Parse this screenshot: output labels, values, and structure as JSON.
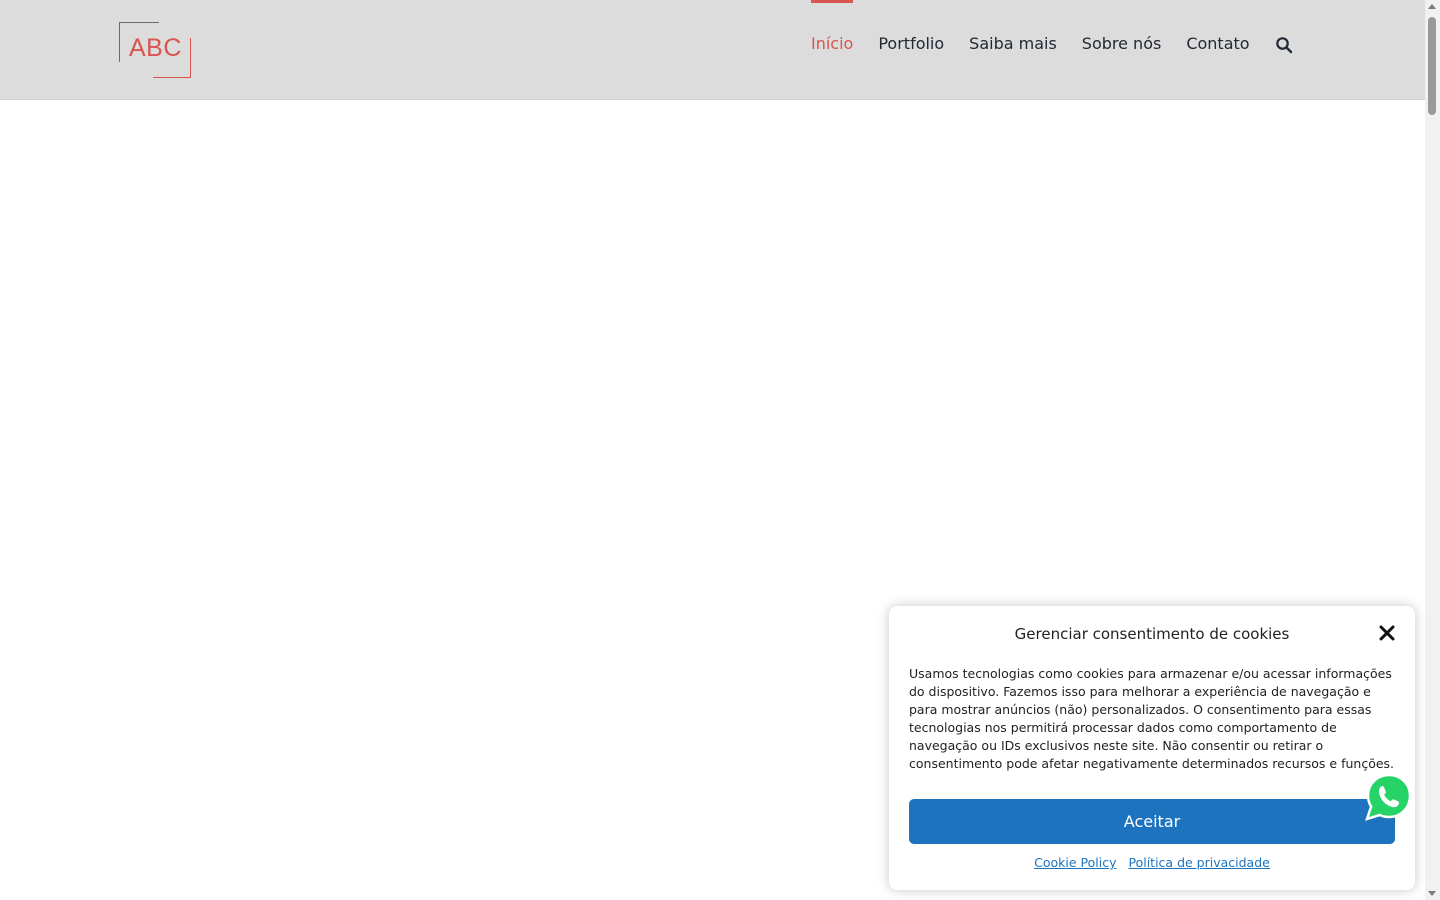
{
  "header": {
    "logo_text": "ABC",
    "nav": [
      {
        "label": "Início",
        "active": true
      },
      {
        "label": "Portfolio",
        "active": false
      },
      {
        "label": "Saiba mais",
        "active": false
      },
      {
        "label": "Sobre nós",
        "active": false
      },
      {
        "label": "Contato",
        "active": false
      }
    ],
    "search_icon": "search-icon"
  },
  "cookie_dialog": {
    "title": "Gerenciar consentimento de cookies",
    "body": "Usamos tecnologias como cookies para armazenar e/ou acessar informações do dispositivo. Fazemos isso para melhorar a experiência de navegação e para mostrar anúncios (não) personalizados. O consentimento para essas tecnologias nos permitirá processar dados como comportamento de navegação ou IDs exclusivos neste site. Não consentir ou retirar o consentimento pode afetar negativamente determinados recursos e funções.",
    "accept_label": "Aceitar",
    "links": [
      "Cookie Policy",
      "Política de privacidade"
    ]
  },
  "colors": {
    "accent": "#d9534f",
    "button": "#1e73be",
    "header_bg": "#dcdcdc",
    "whatsapp": "#25d366"
  },
  "icons": {
    "close": "close-icon",
    "whatsapp": "whatsapp-icon"
  }
}
